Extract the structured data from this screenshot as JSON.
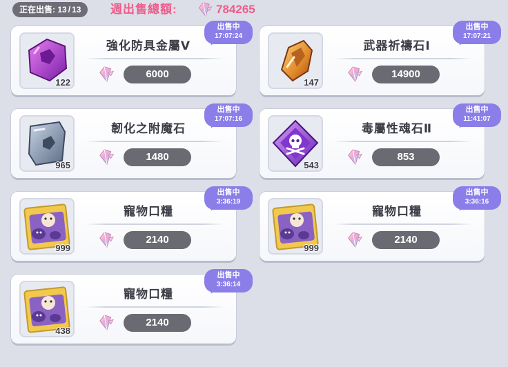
{
  "header": {
    "sale_count_label": "正在出售:",
    "sale_count_current": "13",
    "sale_count_total": "13",
    "weekly_total_label": "週出售總額:",
    "weekly_total_value": "784265",
    "currency_icon": "crystal-gem-icon"
  },
  "colors": {
    "accent_pink": "#ee5c8c",
    "status_purple": "#8b7ee8",
    "price_bg": "#6a6a72",
    "card_bg": "#ffffff"
  },
  "listings": [
    {
      "name": "強化防具金屬Ⅴ",
      "quantity": "122",
      "price": "6000",
      "status": "出售中",
      "time": "17:07:24",
      "icon": "purple-metal-ore-icon"
    },
    {
      "name": "武器祈禱石Ⅰ",
      "quantity": "147",
      "price": "14900",
      "status": "出售中",
      "time": "17:07:21",
      "icon": "orange-prayer-stone-icon"
    },
    {
      "name": "韌化之附魔石",
      "quantity": "965",
      "price": "1480",
      "status": "出售中",
      "time": "17:07:16",
      "icon": "gray-enchant-stone-icon"
    },
    {
      "name": "毒屬性魂石Ⅱ",
      "quantity": "543",
      "price": "853",
      "status": "出售中",
      "time": "11:41:07",
      "icon": "poison-skull-soulstone-icon"
    },
    {
      "name": "寵物口糧",
      "quantity": "999",
      "price": "2140",
      "status": "出售中",
      "time": "3:36:19",
      "icon": "pet-food-bag-icon"
    },
    {
      "name": "寵物口糧",
      "quantity": "999",
      "price": "2140",
      "status": "出售中",
      "time": "3:36:16",
      "icon": "pet-food-bag-icon"
    },
    {
      "name": "寵物口糧",
      "quantity": "438",
      "price": "2140",
      "status": "出售中",
      "time": "3:36:14",
      "icon": "pet-food-bag-icon"
    }
  ]
}
